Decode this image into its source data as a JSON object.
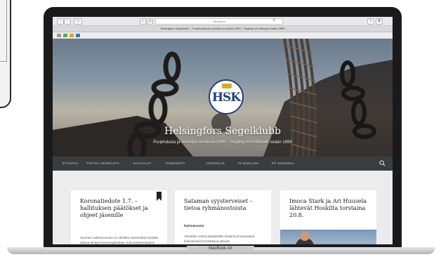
{
  "browser": {
    "address": "hsk.fi/web",
    "tab_title": "Helsingfors Segelklubb – Purjehdusta ja veneilyä vuodesta 1899 – Segling och båtsport sedan 1899"
  },
  "site": {
    "logo_text": "HSK",
    "title": "Helsingfors Segelklubb",
    "description": "Purjehdusta ja veneilyä vuodesta 1899 – Segling och båtsport sedan 1899"
  },
  "nav": {
    "items": [
      "ETUSIVU",
      "TIETOA SEURASTA",
      "KILPAILUT",
      "TOIMINNOT",
      "JÄSENILLE",
      "IN ENGLISH",
      "PÅ SVENSKA"
    ]
  },
  "posts": [
    {
      "title": "Koronatiedote 1.7. – hallituksen päätökset ja ohjeet jäsenille",
      "excerpt": "Suomen valtioneuvosto on edelleen levenntänyt kevään aikana tehtyjä koronarajoituksia. Kokoontumisrajoitus on"
    },
    {
      "title": "Sataman syysterveiset – tietoa ryhmänostoista",
      "subheading": "Ryhmänostot",
      "excerpt": "Veneiden nostot järjestetään tiistaina ja lauantaina kalenterissa ilmoitettuina päivinä"
    },
    {
      "title": "Imoca Stark ja Ari Huusela lähtevät Hoskilta torstaina 20.8."
    }
  ],
  "device": {
    "label": "MacBook Air"
  },
  "icons": {
    "search": "search-icon",
    "bookmark": "bookmark-icon"
  },
  "colors": {
    "nav_bg": "#3b3c3e",
    "logo_blue": "#1f3f7a",
    "crown_gold": "#d4aa33"
  }
}
